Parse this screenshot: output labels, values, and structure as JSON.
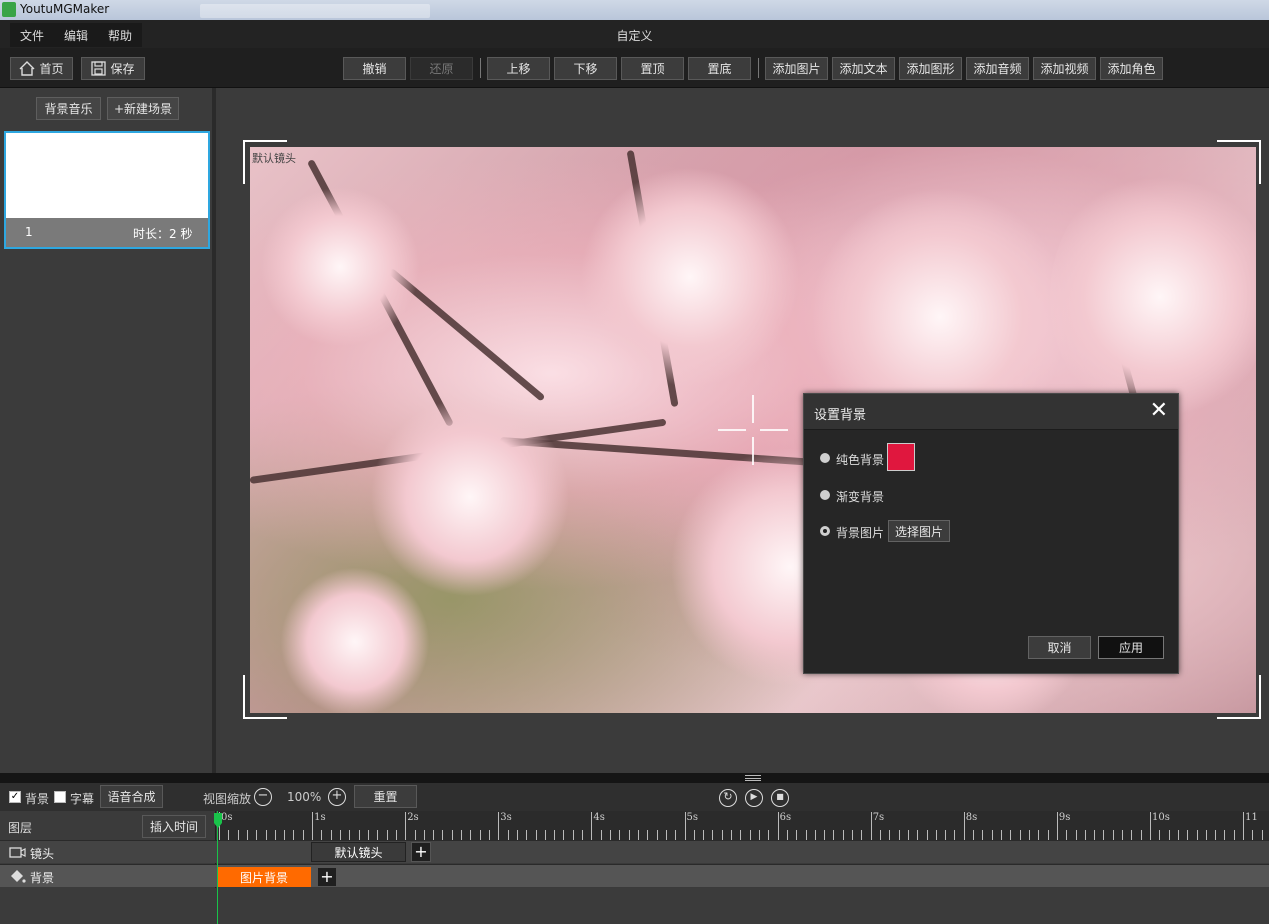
{
  "window": {
    "app_title": "YoutuMGMaker",
    "center_title": "自定义"
  },
  "menu": {
    "items": [
      "文件",
      "编辑",
      "帮助"
    ]
  },
  "toolbar": {
    "home_label": "首页",
    "save_label": "保存",
    "undo_label": "撤销",
    "redo_label": "还原",
    "move_up_label": "上移",
    "move_down_label": "下移",
    "to_top_label": "置顶",
    "to_bottom_label": "置底",
    "add_image_label": "添加图片",
    "add_text_label": "添加文本",
    "add_shape_label": "添加图形",
    "add_audio_label": "添加音频",
    "add_video_label": "添加视频",
    "add_character_label": "添加角色"
  },
  "left_panel": {
    "bg_music_label": "背景音乐",
    "new_scene_label": "+新建场景",
    "scene": {
      "index": "1",
      "duration": "时长：2 秒"
    }
  },
  "canvas": {
    "camera_label": "默认镜头"
  },
  "dialog": {
    "title": "设置背景",
    "close_glyph": "✕",
    "options": [
      {
        "label": "纯色背景",
        "selected": false
      },
      {
        "label": "渐变背景",
        "selected": false
      },
      {
        "label": "背景图片",
        "selected": true
      }
    ],
    "solid_color": "#e0173e",
    "choose_image_label": "选择图片",
    "cancel_label": "取消",
    "apply_label": "应用"
  },
  "timeline_controls": {
    "background_label": "背景",
    "background_checked": true,
    "subtitle_label": "字幕",
    "subtitle_checked": false,
    "tts_label": "语音合成",
    "zoom_label": "视图缩放",
    "zoom_value": "100%",
    "reset_label": "重置"
  },
  "timeline": {
    "layers_label": "图层",
    "insert_time_label": "插入时间",
    "ruler_labels": [
      "0s",
      "1s",
      "2s",
      "3s",
      "4s",
      "5s",
      "6s",
      "7s",
      "8s",
      "9s",
      "10s",
      "11"
    ],
    "tracks": [
      {
        "name": "镜头",
        "clip_label": "默认镜头"
      },
      {
        "name": "背景",
        "clip_label": "图片背景"
      }
    ]
  },
  "colors": {
    "accent_blue": "#2ea7e0",
    "clip_orange": "#ff6a00",
    "playhead_green": "#19c34a"
  }
}
